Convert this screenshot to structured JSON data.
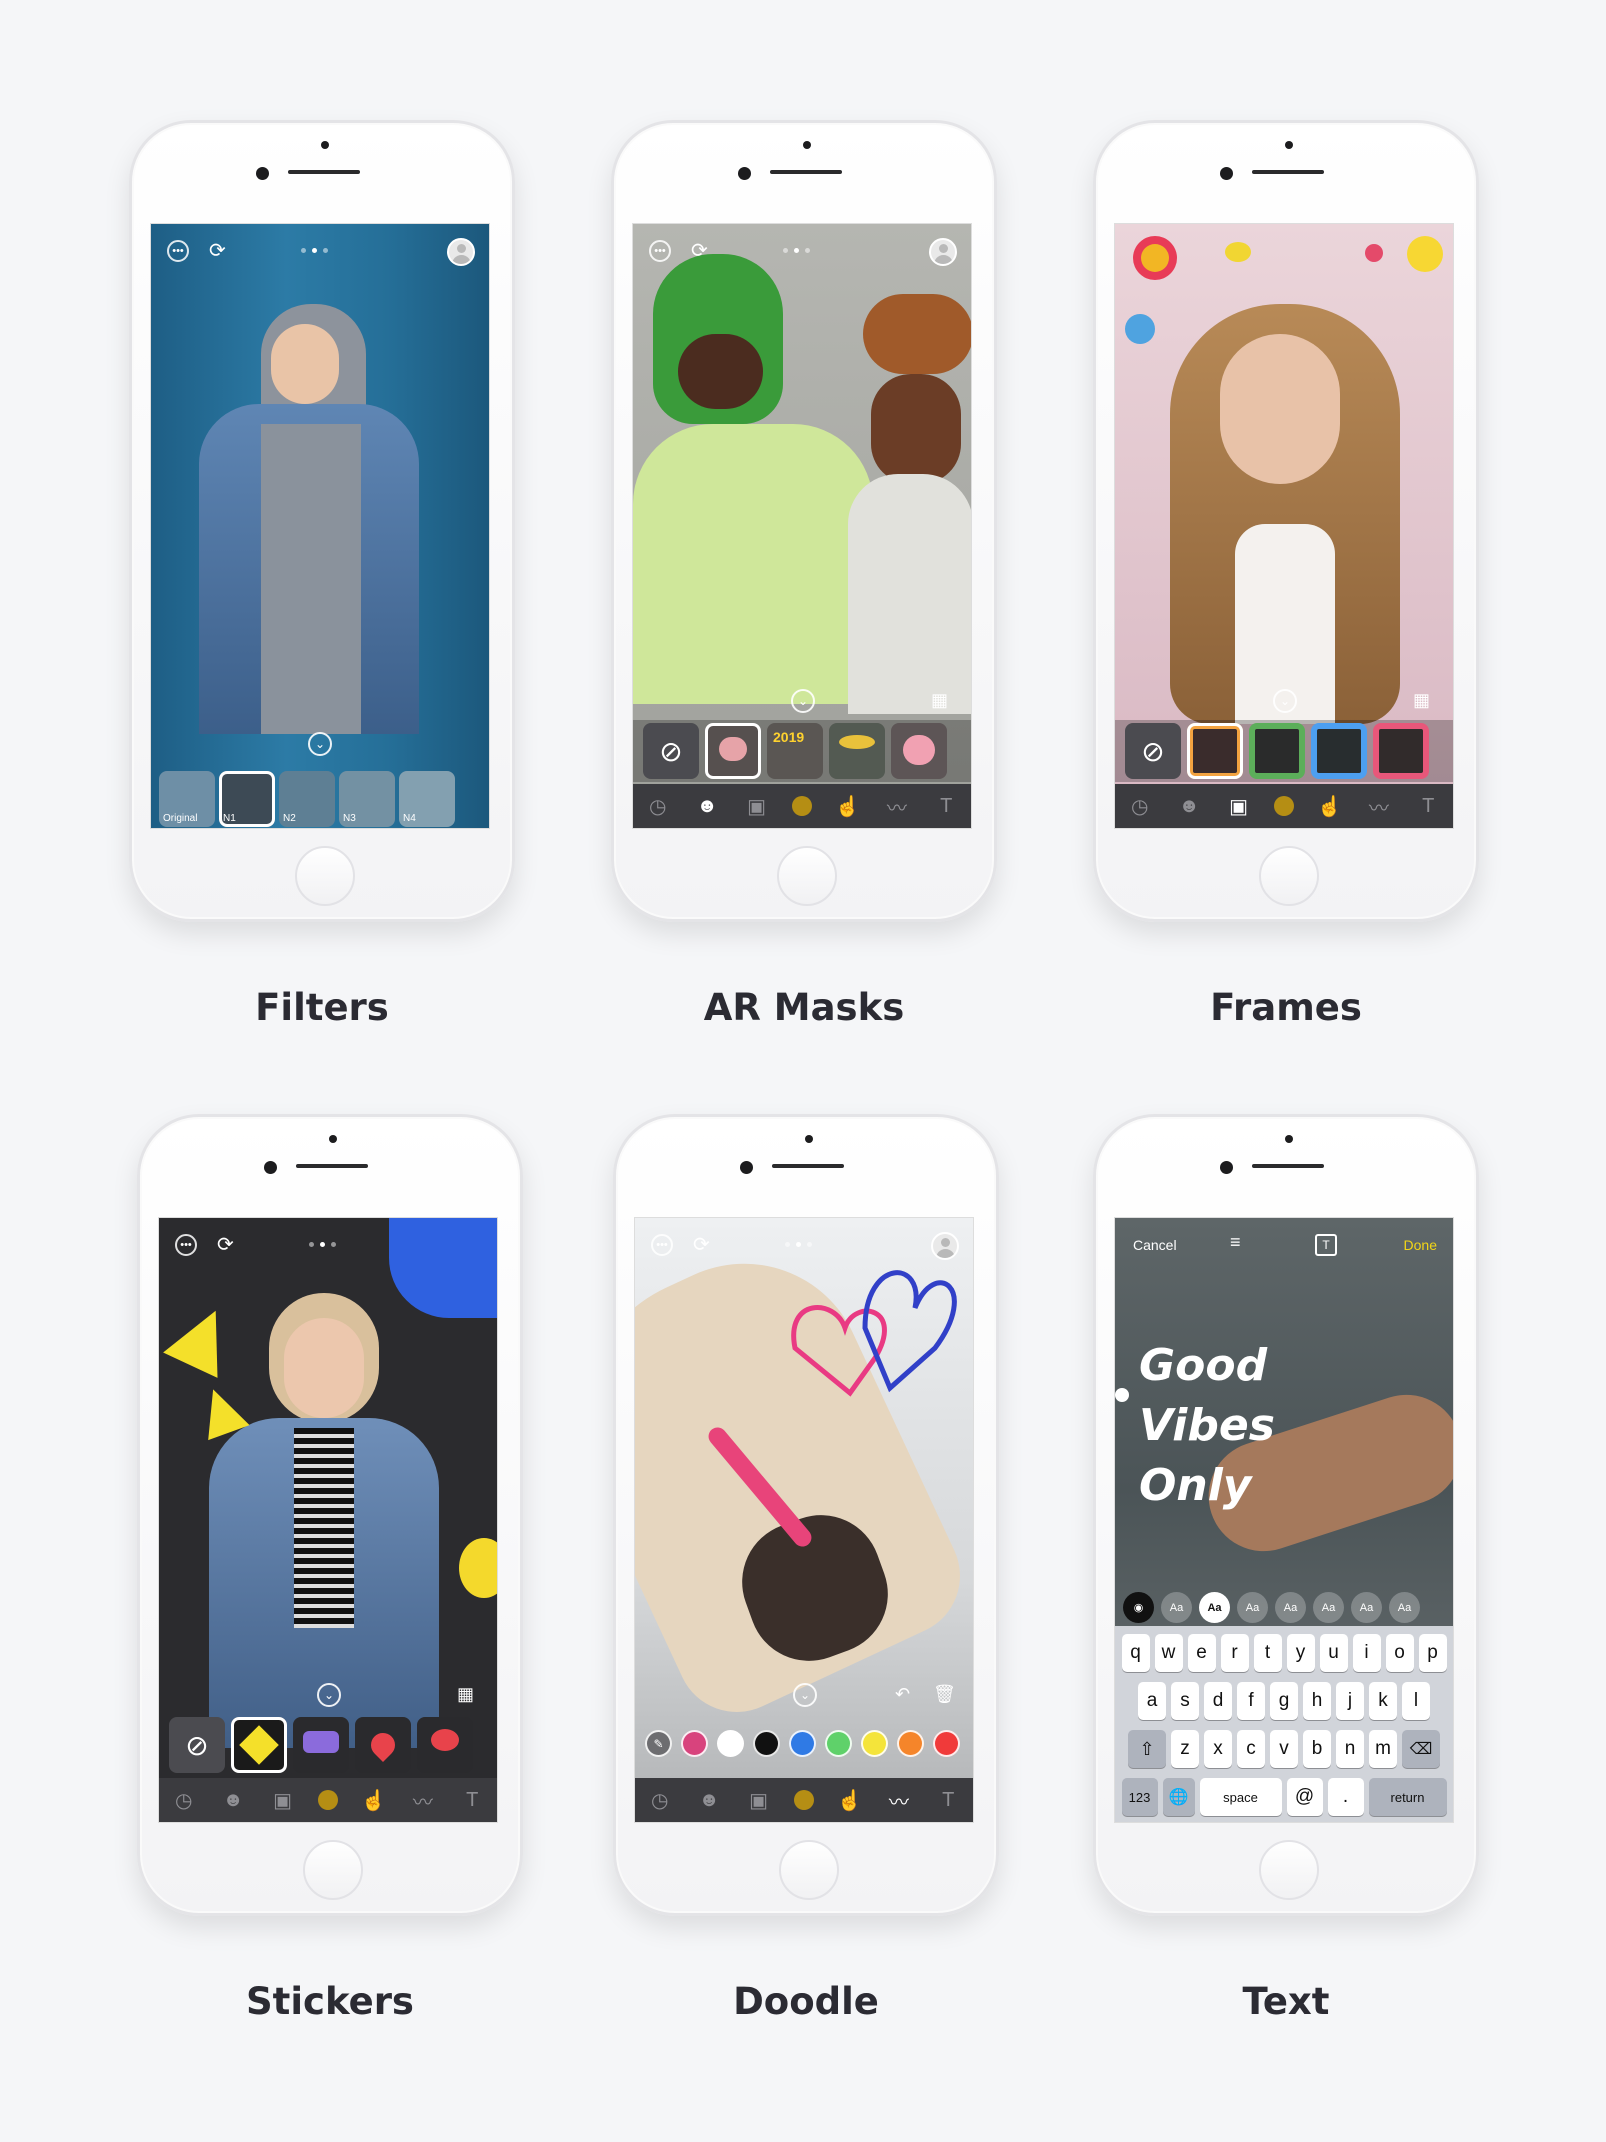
{
  "cards": [
    {
      "caption": "Filters"
    },
    {
      "caption": "AR Masks"
    },
    {
      "caption": "Frames"
    },
    {
      "caption": "Stickers"
    },
    {
      "caption": "Doodle"
    },
    {
      "caption": "Text"
    }
  ],
  "filters": {
    "thumbs": [
      "Original",
      "N1",
      "N2",
      "N3",
      "N4"
    ]
  },
  "ar_masks": {
    "mask_badge": "2019"
  },
  "text_editor": {
    "cancel": "Cancel",
    "done": "Done",
    "overlay_lines": [
      "Good",
      "Vibes",
      "Only"
    ],
    "font_style_sample": "Aa",
    "keyboard": {
      "row1": [
        "q",
        "w",
        "e",
        "r",
        "t",
        "y",
        "u",
        "i",
        "o",
        "p"
      ],
      "row2": [
        "a",
        "s",
        "d",
        "f",
        "g",
        "h",
        "j",
        "k",
        "l"
      ],
      "row3": [
        "z",
        "x",
        "c",
        "v",
        "b",
        "n",
        "m"
      ],
      "numbers": "123",
      "space": "space",
      "at": "@",
      "period": ".",
      "return": "return"
    }
  },
  "colors": {
    "accent_done": "#f2d516",
    "doodle_swatches": [
      "#ffffff",
      "#111111",
      "#2f7ae5",
      "#5fd16a",
      "#f4e43a",
      "#f5852a",
      "#f03a3a"
    ]
  }
}
